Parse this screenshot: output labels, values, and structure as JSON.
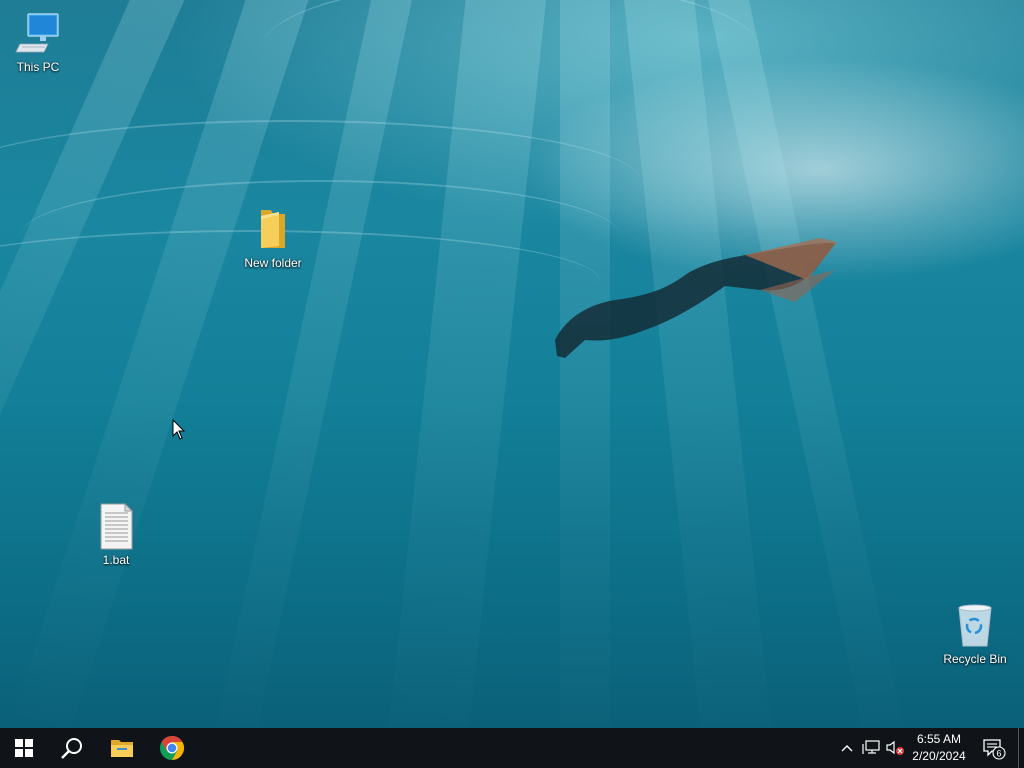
{
  "desktop": {
    "icons": [
      {
        "name": "this-pc-icon",
        "label": "This PC"
      },
      {
        "name": "new-folder-icon",
        "label": "New folder"
      },
      {
        "name": "bat-file-icon",
        "label": "1.bat"
      },
      {
        "name": "recycle-bin-icon",
        "label": "Recycle Bin"
      }
    ]
  },
  "taskbar": {
    "start_icon": "windows-logo-icon",
    "search_icon": "search-icon",
    "pinned": [
      "file-explorer-icon",
      "chrome-icon"
    ],
    "tray": {
      "icons": [
        "chevron-up-icon",
        "network-icon",
        "volume-muted-icon"
      ],
      "time": "6:55 AM",
      "date": "2/20/2024",
      "notifications_count": "6"
    }
  },
  "colors": {
    "taskbar": "#101418",
    "folder": "#f3c444",
    "chrome_red": "#db4437",
    "chrome_green": "#0f9d58",
    "chrome_yellow": "#f4b400",
    "chrome_blue": "#4285f4"
  }
}
